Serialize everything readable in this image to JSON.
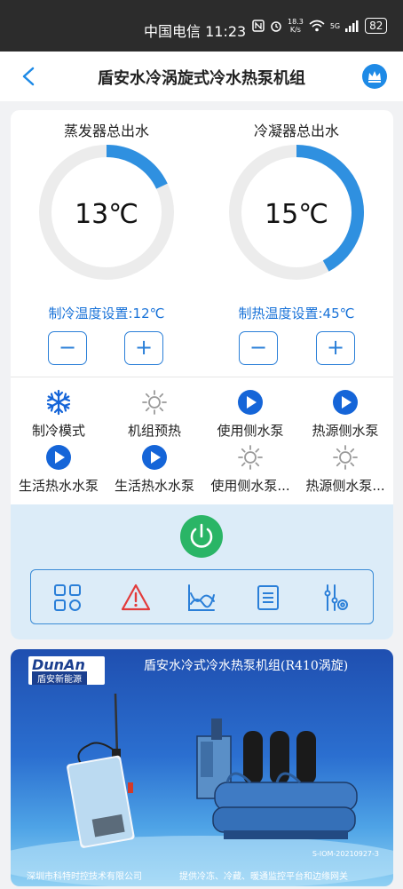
{
  "status_bar": {
    "carrier_time": "中国电信 11:23",
    "speed_value": "18.3",
    "speed_unit": "K/s",
    "network": "5G",
    "battery": "82"
  },
  "header": {
    "title": "盾安水冷涡旋式冷水热泵机组"
  },
  "gauges": [
    {
      "label": "蒸发器总出水",
      "value": "13℃",
      "progress": 0.18,
      "setting": "制冷温度设置:12℃"
    },
    {
      "label": "冷凝器总出水",
      "value": "15℃",
      "progress": 0.42,
      "setting": "制热温度设置:45℃"
    }
  ],
  "stepper": {
    "minus": "−",
    "plus": "+"
  },
  "status_items": [
    {
      "label": "制冷模式",
      "icon": "snowflake-icon",
      "active": true
    },
    {
      "label": "机组预热",
      "icon": "sun-icon",
      "active": false
    },
    {
      "label": "使用侧水泵",
      "icon": "play-icon",
      "active": true
    },
    {
      "label": "热源侧水泵",
      "icon": "play-icon",
      "active": true
    },
    {
      "label": "生活热水水泵",
      "icon": "play-icon",
      "active": true
    },
    {
      "label": "生活热水水泵",
      "icon": "play-icon",
      "active": true
    },
    {
      "label": "使用侧水泵...",
      "icon": "sun-icon",
      "active": false
    },
    {
      "label": "热源侧水泵...",
      "icon": "sun-icon",
      "active": false
    }
  ],
  "toolbar": [
    {
      "icon": "grid-icon"
    },
    {
      "icon": "alarm-icon"
    },
    {
      "icon": "chart-icon"
    },
    {
      "icon": "list-icon"
    },
    {
      "icon": "settings-icon"
    }
  ],
  "colors": {
    "accent": "#1e8ae6",
    "active_blue": "#1565d8",
    "inactive_gray": "#9a9a9a",
    "power_green": "#2ab566",
    "alarm_red": "#e23b3b"
  },
  "banner": {
    "logo_en": "DunAn",
    "logo_cn": "盾安新能源",
    "title": "盾安水冷式冷水热泵机组(R410涡旋)",
    "code": "S-IOM-20210927-3",
    "company": "深圳市科特时控技术有限公司",
    "slogan": "提供冷冻、冷藏、暖通监控平台和边缘网关"
  }
}
